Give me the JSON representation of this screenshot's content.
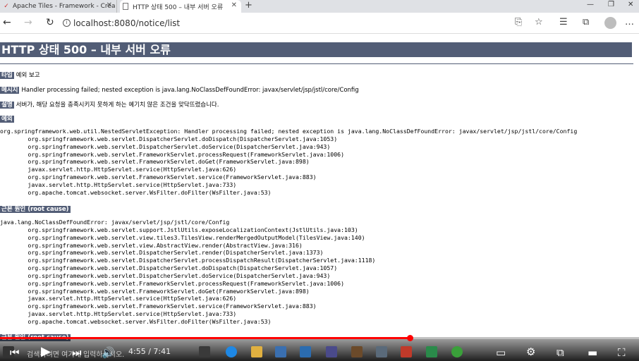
{
  "browser": {
    "tabs": [
      {
        "label": "Apache Tiles - Framework - Crea",
        "active": false
      },
      {
        "label": "HTTP 상태 500 – 내부 서버 오류",
        "active": true
      }
    ],
    "url": "localhost:8080/notice/list"
  },
  "page": {
    "title": "HTTP 상태 500 – 내부 서버 오류",
    "type_label": "타입",
    "type_value": "예외 보고",
    "message_label": "메시지",
    "message_value": "Handler processing failed; nested exception is java.lang.NoClassDefFoundError: javax/servlet/jsp/jstl/core/Config",
    "desc_label": "설명",
    "desc_value": "서버가, 해당 요청을 충족시키지 못하게 하는 예기치 않은 조건을 맞닥뜨렸습니다.",
    "exception_label": "예외",
    "exception_trace": [
      "org.springframework.web.util.NestedServletException: Handler processing failed; nested exception is java.lang.NoClassDefFoundError: javax/servlet/jsp/jstl/core/Config",
      "\torg.springframework.web.servlet.DispatcherServlet.doDispatch(DispatcherServlet.java:1053)",
      "\torg.springframework.web.servlet.DispatcherServlet.doService(DispatcherServlet.java:943)",
      "\torg.springframework.web.servlet.FrameworkServlet.processRequest(FrameworkServlet.java:1006)",
      "\torg.springframework.web.servlet.FrameworkServlet.doGet(FrameworkServlet.java:898)",
      "\tjavax.servlet.http.HttpServlet.service(HttpServlet.java:626)",
      "\torg.springframework.web.servlet.FrameworkServlet.service(FrameworkServlet.java:883)",
      "\tjavax.servlet.http.HttpServlet.service(HttpServlet.java:733)",
      "\torg.apache.tomcat.websocket.server.WsFilter.doFilter(WsFilter.java:53)"
    ],
    "root_cause_label": "근본 원인 (root cause)",
    "root_cause_trace": [
      "java.lang.NoClassDefFoundError: javax/servlet/jsp/jstl/core/Config",
      "\torg.springframework.web.servlet.support.JstlUtils.exposeLocalizationContext(JstlUtils.java:103)",
      "\torg.springframework.web.servlet.view.tiles3.TilesView.renderMergedOutputModel(TilesView.java:140)",
      "\torg.springframework.web.servlet.view.AbstractView.render(AbstractView.java:316)",
      "\torg.springframework.web.servlet.DispatcherServlet.render(DispatcherServlet.java:1373)",
      "\torg.springframework.web.servlet.DispatcherServlet.processDispatchResult(DispatcherServlet.java:1118)",
      "\torg.springframework.web.servlet.DispatcherServlet.doDispatch(DispatcherServlet.java:1057)",
      "\torg.springframework.web.servlet.DispatcherServlet.doService(DispatcherServlet.java:943)",
      "\torg.springframework.web.servlet.FrameworkServlet.processRequest(FrameworkServlet.java:1006)",
      "\torg.springframework.web.servlet.FrameworkServlet.doGet(FrameworkServlet.java:898)",
      "\tjavax.servlet.http.HttpServlet.service(HttpServlet.java:626)",
      "\torg.springframework.web.servlet.FrameworkServlet.service(FrameworkServlet.java:883)",
      "\tjavax.servlet.http.HttpServlet.service(HttpServlet.java:733)",
      "\torg.apache.tomcat.websocket.server.WsFilter.doFilter(WsFilter.java:53)"
    ],
    "root_cause_label_2": "근본 원인 (root cause)"
  },
  "player": {
    "current_time": "4:55",
    "separator": " / ",
    "total_time": "7:41",
    "progress_fraction": 0.641,
    "icons": [
      "skip-previous-icon",
      "play-icon",
      "skip-next-icon",
      "volume-icon",
      "subtitles-icon",
      "settings-icon",
      "miniplayer-icon",
      "theater-icon",
      "fullscreen-icon"
    ]
  },
  "taskbar": {
    "search_placeholder": "검색하려면 여기에 입력하십시오."
  },
  "colors": {
    "heading_bg": "#525d76",
    "progress": "#ff0000",
    "tab_bar": "#dfe1e5"
  }
}
